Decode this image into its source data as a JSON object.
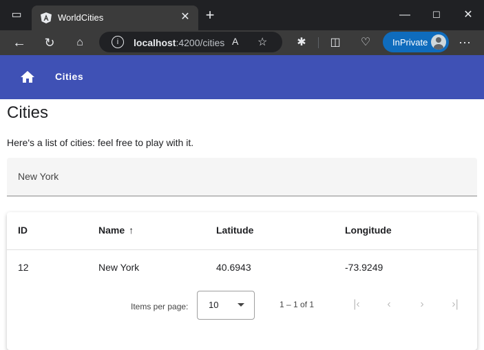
{
  "browser": {
    "tab_title": "WorldCities",
    "address": {
      "host": "localhost",
      "path": ":4200/cities"
    },
    "inprivate_label": "InPrivate"
  },
  "app": {
    "nav_label": "Cities",
    "page_title": "Cities",
    "subtitle": "Here's a list of cities: feel free to play with it.",
    "filter_value": "New York"
  },
  "table": {
    "columns": [
      "ID",
      "Name",
      "Latitude",
      "Longitude"
    ],
    "rows": [
      {
        "id": "12",
        "name": "New York",
        "latitude": "40.6943",
        "longitude": "-73.9249"
      }
    ]
  },
  "paginator": {
    "items_per_page_label": "Items per page:",
    "page_size": "10",
    "range_label": "1 – 1 of 1"
  },
  "colors": {
    "primary": "#3f51b5",
    "inprivate": "#0f6cbd"
  }
}
